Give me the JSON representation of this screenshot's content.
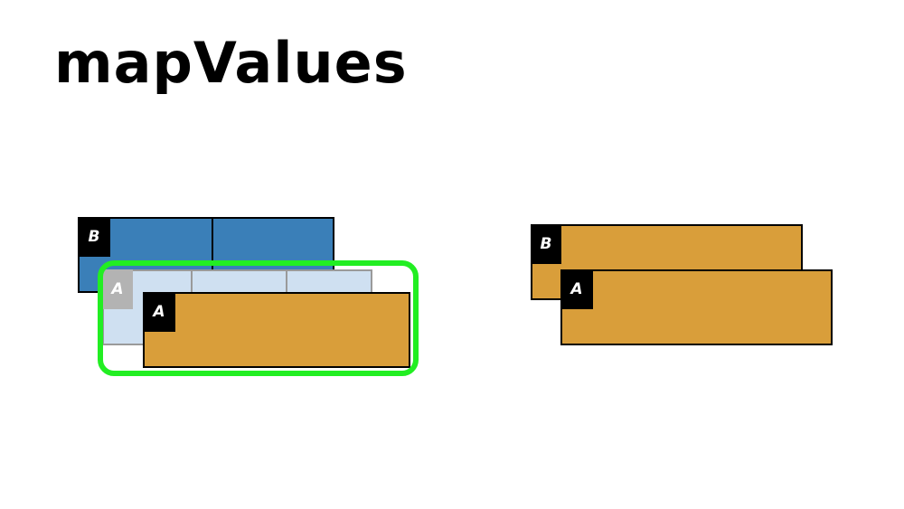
{
  "title": "mapValues",
  "colors": {
    "blue": "#3a7fb8",
    "light_blue": "#cfe0f1",
    "orange": "#d99e3a",
    "black": "#000000",
    "grey_label": "#b3b3b3",
    "grey_border": "#9a9a9a",
    "highlight": "#22ee22"
  },
  "left": {
    "b_label": "B",
    "a_faded_label": "A",
    "a_label": "A"
  },
  "right": {
    "b_label": "B",
    "a_label": "A"
  }
}
